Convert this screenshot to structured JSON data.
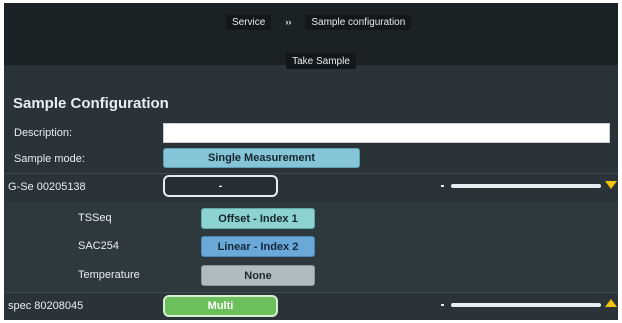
{
  "breadcrumb": {
    "items": [
      "Service",
      "Sample configuration"
    ],
    "separator": "››"
  },
  "take_sample_label": "Take Sample",
  "section_title": "Sample Configuration",
  "form": {
    "description_label": "Description:",
    "description_value": "",
    "sample_mode_label": "Sample mode:",
    "sample_mode_value": "Single Measurement"
  },
  "devices": [
    {
      "name": "G-Se 00205138",
      "button": "-",
      "expanded": true,
      "arrow": "down"
    },
    {
      "name": "spec 80208045",
      "button": "Multi",
      "expanded": false,
      "arrow": "up"
    }
  ],
  "parameters": [
    {
      "label": "TSSeq",
      "value": "Offset - Index 1"
    },
    {
      "label": "SAC254",
      "value": "Linear - Index 2"
    },
    {
      "label": "Temperature",
      "value": "None"
    }
  ],
  "colors": {
    "screen_bg": "#2a3438",
    "accent_yellow": "#f3c20a",
    "mode_blue": "#86c4d8",
    "multi_green": "#6cc05c"
  }
}
